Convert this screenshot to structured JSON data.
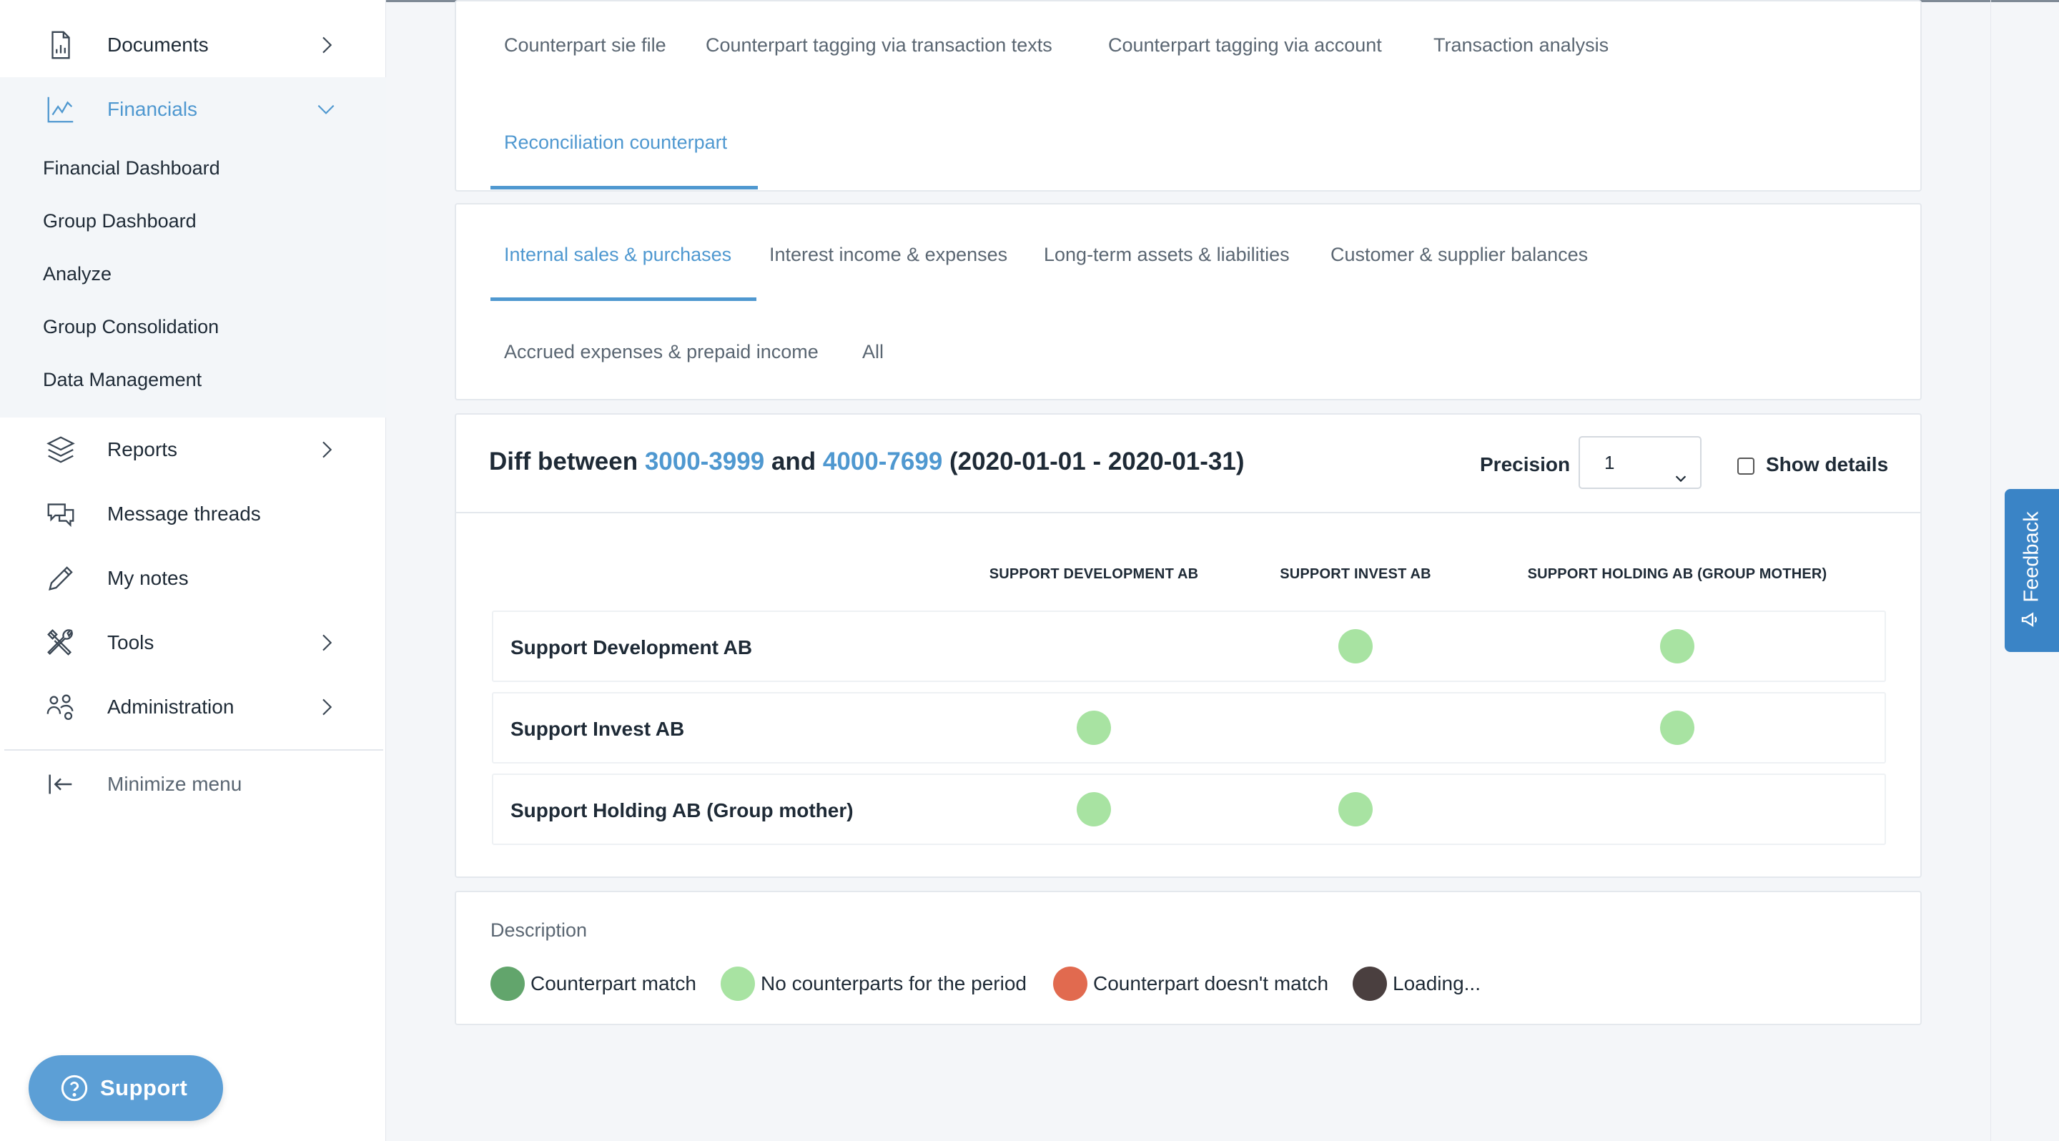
{
  "colors": {
    "accent": "#4f98d0",
    "match": "#62a56c",
    "no_counterparts": "#a8e3a2",
    "mismatch": "#e16a4f",
    "loading": "#4a3f3f",
    "feedback": "#3a84c6",
    "support": "#5c9fd6"
  },
  "sidebar": {
    "documents": {
      "label": "Documents",
      "icon": "document-chart-icon"
    },
    "financials": {
      "label": "Financials",
      "icon": "line-chart-icon",
      "items": [
        "Financial Dashboard",
        "Group Dashboard",
        "Analyze",
        "Group Consolidation",
        "Data Management"
      ]
    },
    "reports": {
      "label": "Reports",
      "icon": "layers-icon"
    },
    "message_threads": {
      "label": "Message threads",
      "icon": "chat-bubbles-icon"
    },
    "my_notes": {
      "label": "My notes",
      "icon": "pencil-icon"
    },
    "tools": {
      "label": "Tools",
      "icon": "tools-icon"
    },
    "administration": {
      "label": "Administration",
      "icon": "users-gear-icon"
    },
    "minimize": {
      "label": "Minimize menu",
      "icon": "collapse-left-icon"
    },
    "support": {
      "label": "Support",
      "icon": "question-circle-icon"
    }
  },
  "top_tabs": {
    "items": [
      "Counterpart sie file",
      "Counterpart tagging via transaction texts",
      "Counterpart tagging via account",
      "Transaction analysis"
    ],
    "active": "Reconciliation counterpart"
  },
  "sub_tabs": {
    "active": "Internal sales & purchases",
    "items": [
      "Interest income & expenses",
      "Long-term assets & liabilities",
      "Customer & supplier balances"
    ],
    "row2": [
      "Accrued expenses & prepaid income",
      "All"
    ]
  },
  "diff": {
    "prefix": "Diff between",
    "range1": "3000-3999",
    "conj": "and",
    "range2": "4000-7699",
    "period": "(2020-01-01 - 2020-01-31)",
    "precision_label": "Precision",
    "precision_value": "1",
    "show_details_label": "Show details",
    "show_details_checked": false
  },
  "matrix": {
    "columns": [
      "Support Development AB",
      "Support Invest AB",
      "Support Holding AB (Group mother)"
    ],
    "rows": [
      {
        "label": "Support Development AB",
        "cells": [
          null,
          "no_counterparts",
          "no_counterparts"
        ]
      },
      {
        "label": "Support Invest AB",
        "cells": [
          "no_counterparts",
          null,
          "no_counterparts"
        ]
      },
      {
        "label": "Support Holding AB (Group mother)",
        "cells": [
          "no_counterparts",
          "no_counterparts",
          null
        ]
      }
    ]
  },
  "description": {
    "title": "Description",
    "legend": [
      {
        "status": "match",
        "label": "Counterpart match"
      },
      {
        "status": "no_counterparts",
        "label": "No counterparts for the period"
      },
      {
        "status": "mismatch",
        "label": "Counterpart doesn't match"
      },
      {
        "status": "loading",
        "label": "Loading..."
      }
    ]
  },
  "feedback": {
    "label": "Feedback",
    "icon": "megaphone-icon"
  }
}
